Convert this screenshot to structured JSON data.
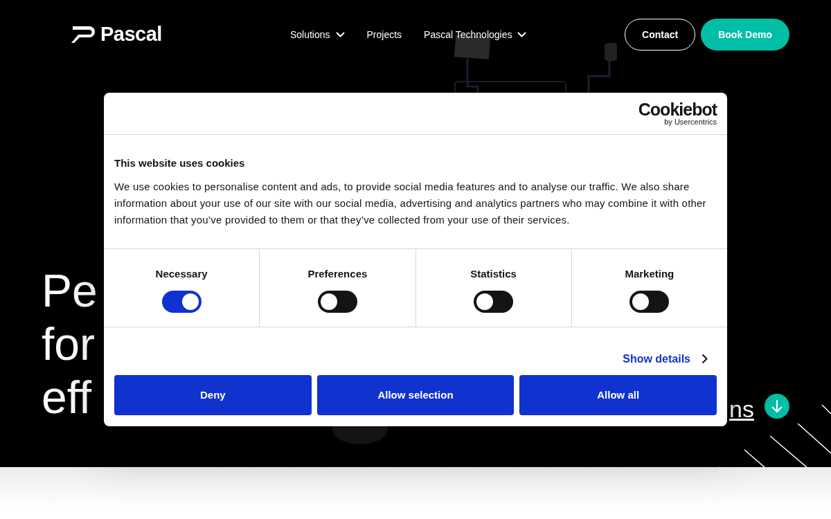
{
  "header": {
    "logo": "Pascal",
    "nav": [
      {
        "label": "Solutions",
        "dropdown": true
      },
      {
        "label": "Projects",
        "dropdown": false
      },
      {
        "label": "Pascal Technologies",
        "dropdown": true
      }
    ],
    "buttons": [
      {
        "label": "Contact",
        "kind": "outline"
      },
      {
        "label": "Book Demo",
        "kind": "filled"
      }
    ]
  },
  "hero": {
    "headline_lines": [
      "Pe",
      "for",
      "eff"
    ],
    "link": "ns"
  },
  "cookie_dialog": {
    "brand": "Cookiebot",
    "brand_sub": "by Usercentrics",
    "title": "This website uses cookies",
    "text": "We use cookies to personalise content and ads, to provide social media features and to analyse our traffic. We also share information about your use of our site with our social media, advertising and analytics partners who may combine it with other information that you’ve provided to them or that they’ve collected from your use of their services.",
    "categories": [
      {
        "label": "Necessary",
        "checked": true
      },
      {
        "label": "Preferences",
        "checked": false
      },
      {
        "label": "Statistics",
        "checked": false
      },
      {
        "label": "Marketing",
        "checked": false
      }
    ],
    "details_link": "Show details",
    "buttons": [
      "Deny",
      "Allow selection",
      "Allow all"
    ]
  }
}
